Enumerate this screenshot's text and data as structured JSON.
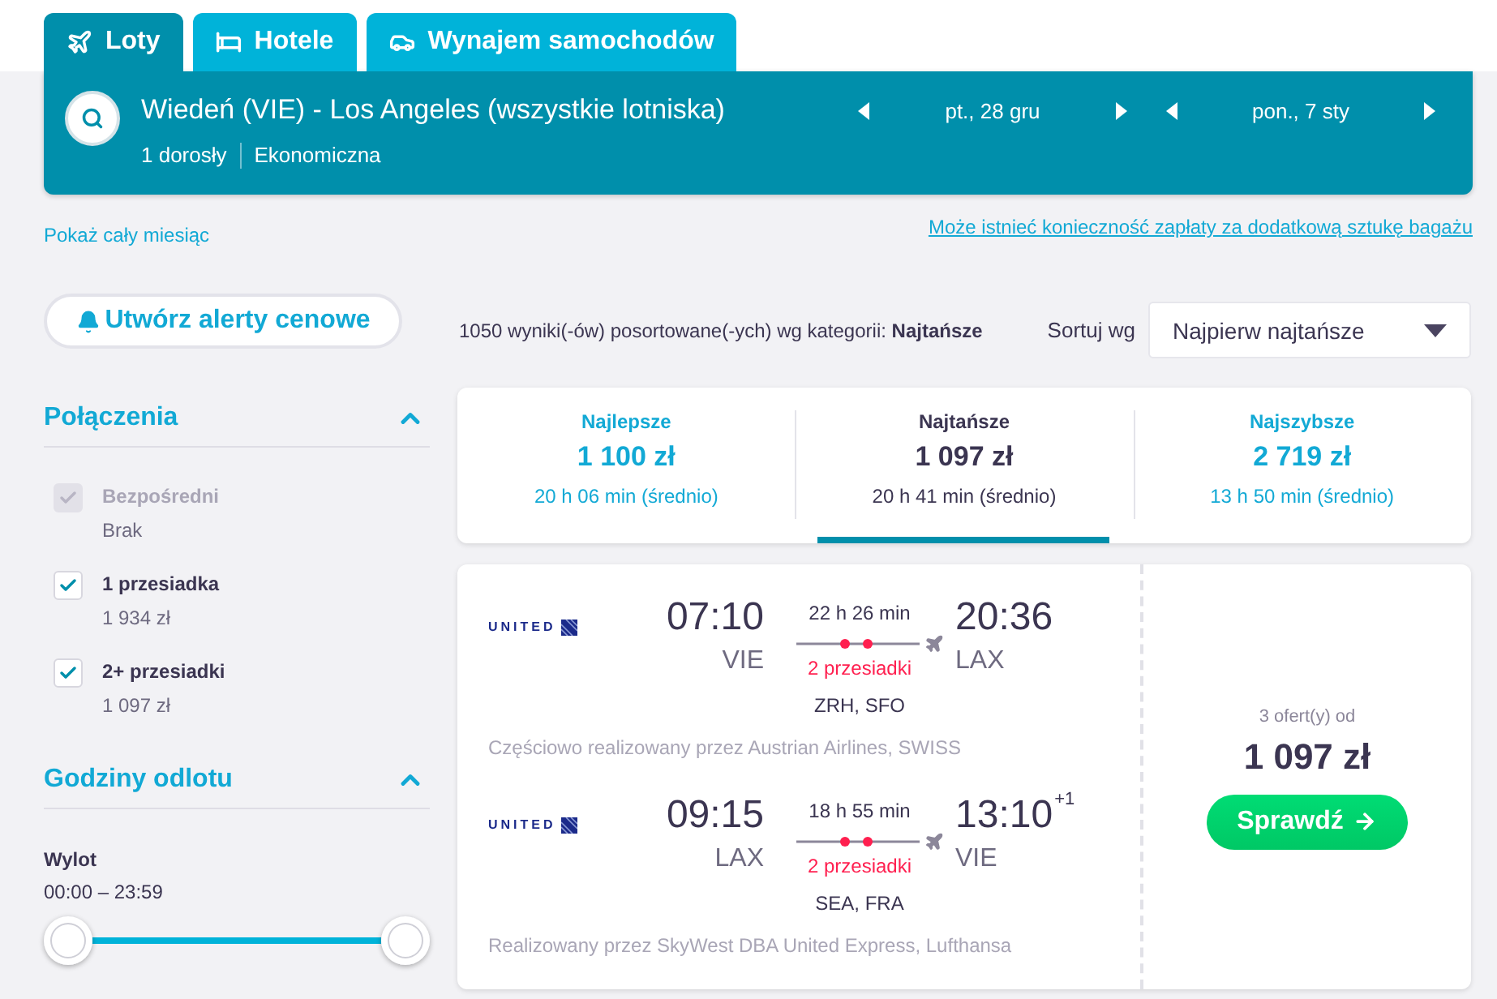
{
  "tabs": [
    {
      "kind": "flights",
      "label": "Loty",
      "selected": true
    },
    {
      "kind": "hotels",
      "label": "Hotele",
      "selected": false
    },
    {
      "kind": "cars",
      "label": "Wynajem samochodów",
      "selected": false
    }
  ],
  "search": {
    "route": "Wiedeń (VIE) - Los Angeles (wszystkie lotniska)",
    "passengers": "1 dorosły",
    "cabin": "Ekonomiczna",
    "dates": [
      {
        "label": "pt., 28 gru"
      },
      {
        "label": "pon., 7 sty"
      }
    ]
  },
  "month_link": "Pokaż cały miesiąc",
  "baggage_link": "Może istnieć konieczność zapłaty za dodatkową sztukę bagażu",
  "sidebar": {
    "alert_button": "Utwórz alerty cenowe",
    "filters": [
      {
        "kind": "checklist",
        "title": "Połączenia",
        "expanded": true,
        "options": [
          {
            "label": "Bezpośredni",
            "price": "Brak",
            "checked": true,
            "disabled": true
          },
          {
            "label": "1 przesiadka",
            "price": "1 934 zł",
            "checked": true,
            "disabled": false
          },
          {
            "label": "2+ przesiadki",
            "price": "1 097 zł",
            "checked": true,
            "disabled": false
          }
        ]
      },
      {
        "kind": "time_range",
        "title": "Godziny odlotu",
        "expanded": true,
        "label": "Wylot",
        "range": "00:00 – 23:59",
        "thumbs": [
          {
            "level": 0
          },
          {
            "level": 1
          }
        ]
      }
    ]
  },
  "results": {
    "summary": "1050 wyniki(-ów) posortowane(-ych) wg kategorii: **Najtańsze**",
    "sort_label": "Sortuj wg",
    "sort_select": {
      "value": "Najpierw najtańsze"
    },
    "sort_tabs": [
      {
        "label": "Najlepsze",
        "price": "1 100 zł",
        "duration": "20 h 06 min (średnio)",
        "selected": false
      },
      {
        "label": "Najtańsze",
        "price": "1 097 zł",
        "duration": "20 h 41 min (średnio)",
        "selected": true
      },
      {
        "label": "Najszybsze",
        "price": "2 719 zł",
        "duration": "13 h 50 min (średnio)",
        "selected": false
      }
    ],
    "flight_card": {
      "legs": [
        {
          "logo": "UNITED",
          "depart_time": "07:10",
          "depart_airport": "VIE",
          "duration": "22 h 26 min",
          "stops": "2 przesiadki",
          "stopovers": "ZRH, SFO",
          "arrive_time": "20:36",
          "arrive_airport": "LAX",
          "operated_by": "Częściowo realizowany przez Austrian Airlines, SWISS"
        },
        {
          "logo": "UNITED",
          "depart_time": "09:15",
          "depart_airport": "LAX",
          "duration": "18 h 55 min",
          "stops": "2 przesiadki",
          "stopovers": "SEA, FRA",
          "arrive_time": "13:10",
          "day_offset": "+1",
          "arrive_airport": "VIE",
          "operated_by": "Realizowany przez SkyWest DBA United Express, Lufthansa"
        }
      ],
      "offers": "3 ofert(y) od",
      "price": "1 097 zł",
      "button": "Sprawdź"
    }
  }
}
